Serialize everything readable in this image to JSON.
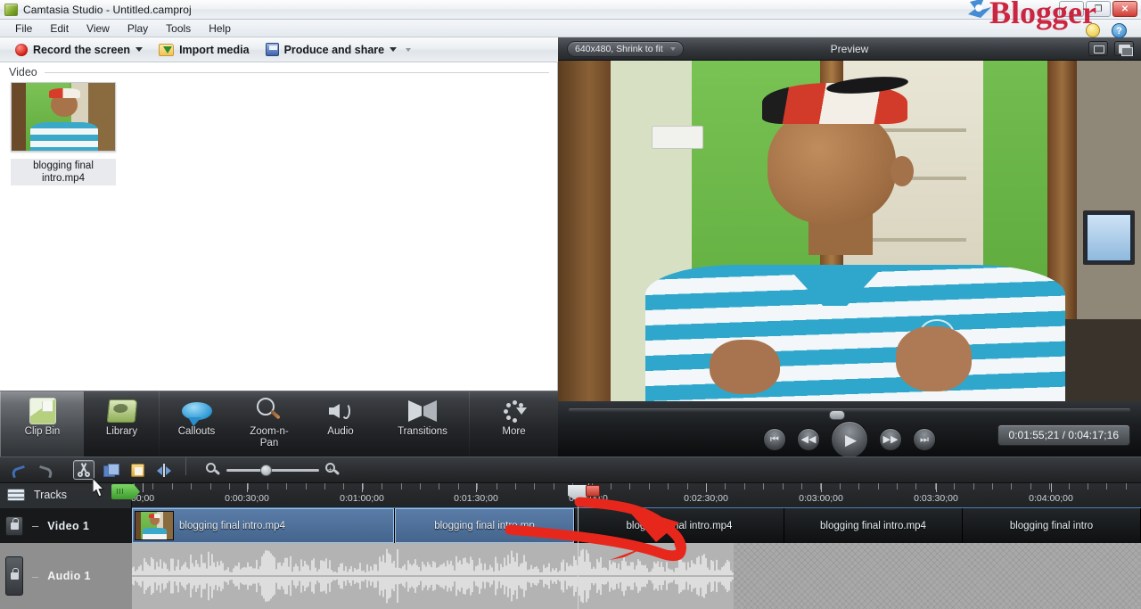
{
  "window": {
    "title": "Camtasia Studio - Untitled.camproj",
    "icon": "camtasia-icon",
    "controls": {
      "minimize": "_",
      "maximize": "❐",
      "close": "✕"
    }
  },
  "menu": {
    "items": [
      "File",
      "Edit",
      "View",
      "Play",
      "Tools",
      "Help"
    ]
  },
  "toolbar": {
    "record_label": "Record the screen",
    "import_label": "Import media",
    "produce_label": "Produce and share"
  },
  "clip_bin": {
    "group_label": "Video",
    "clips": [
      {
        "name": "blogging final intro.mp4"
      }
    ]
  },
  "tabs": [
    {
      "label": "Clip Bin",
      "icon": "clip-bin-icon",
      "active": true
    },
    {
      "label": "Library",
      "icon": "library-icon",
      "active": false
    },
    {
      "label": "Callouts",
      "icon": "callout-bubble-icon",
      "active": false
    },
    {
      "label": "Zoom-n-Pan",
      "icon": "magnifier-icon",
      "active": false
    },
    {
      "label": "Audio",
      "icon": "speaker-icon",
      "active": false
    },
    {
      "label": "Transitions",
      "icon": "transitions-icon",
      "active": false
    },
    {
      "label": "More",
      "icon": "more-dots-icon",
      "active": false
    }
  ],
  "preview": {
    "dimension_label": "640x480, Shrink to fit",
    "title": "Preview",
    "detach_icon": "detach-preview-icon",
    "fullscreen_icon": "fullscreen-icon",
    "controls": {
      "jump_start": "⏮",
      "rewind": "◀◀",
      "play": "▶",
      "forward": "▶▶",
      "jump_end": "⏭"
    },
    "timecode": "0:01:55;21 / 0:04:17;16"
  },
  "timeline_toolbar": {
    "undo_icon": "undo-icon",
    "redo_icon": "redo-icon",
    "cut_icon": "scissors-icon",
    "copy_icon": "copy-icon",
    "paste_icon": "paste-icon",
    "split_icon": "split-icon",
    "zoom_out_icon": "zoom-out-icon",
    "zoom_in_icon": "zoom-in-icon",
    "zoom_value": 36
  },
  "timeline": {
    "tracks_label": "Tracks",
    "ruler_labels": [
      "00;00",
      "0:00:30;00",
      "0:01:00;00",
      "0:01:30;00",
      "0:02:00;0",
      "0:02:30;00",
      "0:03:00;00",
      "0:03:30;00",
      "0:04:00;00"
    ],
    "playhead_position": "0:02:00;00",
    "tracks": [
      {
        "name": "Video  1",
        "type": "video",
        "lock_icon": "lock-icon",
        "clips": [
          {
            "label": "blogging final intro.mp4",
            "selected": true,
            "thumbnail": true
          },
          {
            "label": "blogging final intro.mp",
            "selected": true,
            "thumbnail": false
          },
          {
            "label": "blogging final intro.mp4",
            "selected": false,
            "thumbnail": false
          },
          {
            "label": "blogging final intro.mp4",
            "selected": false,
            "thumbnail": false
          },
          {
            "label": "blogging final intro",
            "selected": false,
            "thumbnail": false
          }
        ]
      },
      {
        "name": "Audio  1",
        "type": "audio",
        "lock_icon": "lock-icon",
        "clips": [
          {
            "label": "",
            "waveform": true
          }
        ]
      }
    ]
  },
  "annotation": {
    "type": "red-curved-arrow",
    "color": "#e8271c"
  },
  "watermark": {
    "text": "Blogger",
    "color": "#c8102e"
  },
  "colors": {
    "accent_blue": "#4a7fb5",
    "selection_blue": "#5a7da8",
    "record_red": "#d41a0f",
    "panel_dark": "#232528"
  }
}
